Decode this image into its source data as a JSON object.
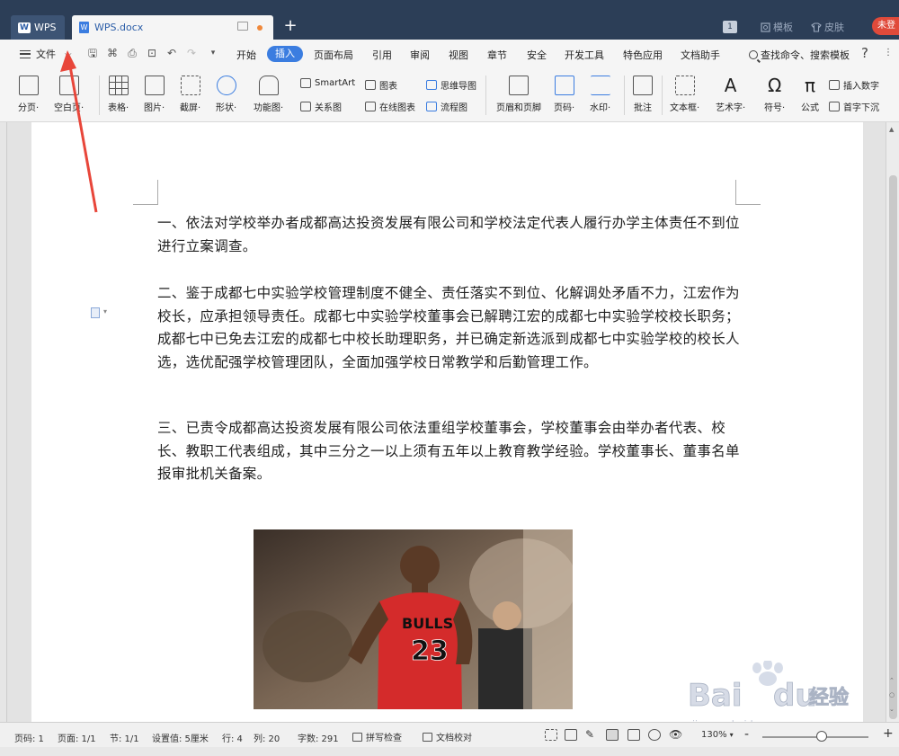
{
  "titlebar": {
    "tabs": [
      {
        "label": "WPS",
        "logo": "W"
      },
      {
        "label": "WPS.docx",
        "logo": "W"
      }
    ],
    "new_tab": "+",
    "counter": "1",
    "template": "模板",
    "skin": "皮肤",
    "login": "未登"
  },
  "menubar": {
    "file": "文件",
    "items": [
      "开始",
      "插入",
      "页面布局",
      "引用",
      "审阅",
      "视图",
      "章节",
      "安全",
      "开发工具",
      "特色应用",
      "文档助手"
    ],
    "active": "插入",
    "search": "查找命令、搜索模板",
    "help": "?",
    "more": "⋮"
  },
  "ribbon": {
    "large": [
      {
        "label": "分页·",
        "icon": "page-break-icon"
      },
      {
        "label": "空白页·",
        "icon": "blank-page-icon"
      },
      {
        "label": "表格·",
        "icon": "table-icon"
      },
      {
        "label": "图片·",
        "icon": "picture-icon"
      },
      {
        "label": "截屏·",
        "icon": "screenshot-icon"
      },
      {
        "label": "形状·",
        "icon": "shape-icon"
      },
      {
        "label": "功能图·",
        "icon": "function-chart-icon"
      },
      {
        "label": "页眉和页脚",
        "icon": "header-footer-icon"
      },
      {
        "label": "页码·",
        "icon": "page-number-icon"
      },
      {
        "label": "水印·",
        "icon": "watermark-icon"
      },
      {
        "label": "批注",
        "icon": "comment-icon"
      },
      {
        "label": "文本框·",
        "icon": "textbox-icon"
      },
      {
        "label": "艺术字·",
        "icon": "wordart-icon"
      },
      {
        "label": "符号·",
        "icon": "symbol-icon"
      },
      {
        "label": "公式",
        "icon": "formula-icon"
      }
    ],
    "small": [
      {
        "label": "SmartArt",
        "icon": "smartart-icon"
      },
      {
        "label": "关系图",
        "icon": "relation-chart-icon"
      },
      {
        "label": "图表",
        "icon": "chart-icon"
      },
      {
        "label": "在线图表",
        "icon": "online-chart-icon"
      },
      {
        "label": "思维导图",
        "icon": "mindmap-icon"
      },
      {
        "label": "流程图",
        "icon": "flowchart-icon"
      },
      {
        "label": "插入数字",
        "icon": "insert-number-icon"
      },
      {
        "label": "首字下沉",
        "icon": "drop-cap-icon"
      }
    ]
  },
  "document": {
    "paragraphs": [
      "一、依法对学校举办者成都高达投资发展有限公司和学校法定代表人履行办学主体责任不到位进行立案调查。",
      "二、鉴于成都七中实验学校管理制度不健全、责任落实不到位、化解调处矛盾不力，江宏作为校长，应承担领导责任。成都七中实验学校董事会已解聘江宏的成都七中实验学校校长职务；成都七中已免去江宏的成都七中校长助理职务，并已确定新选派到成都七中实验学校的校长人选，选优配强学校管理团队，全面加强学校日常教学和后勤管理工作。",
      "三、已责令成都高达投资发展有限公司依法重组学校董事会，学校董事会由举办者代表、校长、教职工代表组成，其中三分之一以上须有五年以上教育教学经验。学校董事长、董事名单报审批机关备案。"
    ],
    "photo_jersey": "BULLS",
    "photo_number": "23"
  },
  "statusbar": {
    "page_code": "页码: 1",
    "pages": "页面: 1/1",
    "section": "节: 1/1",
    "setting": "设置值: 5厘米",
    "row": "行: 4",
    "col": "列: 20",
    "words": "字数: 291",
    "spell": "拼写检查",
    "proof": "文档校对",
    "zoom": "130%",
    "zoom_minus": "-",
    "zoom_plus": "+"
  },
  "watermark": {
    "brand": "Bai",
    "brand2": "du",
    "brand_cn": "经验",
    "url": "jingyan.baidu.com"
  },
  "colors": {
    "titlebar": "#2c3e57",
    "accent": "#3b7de0",
    "arrow": "#e8463a"
  }
}
